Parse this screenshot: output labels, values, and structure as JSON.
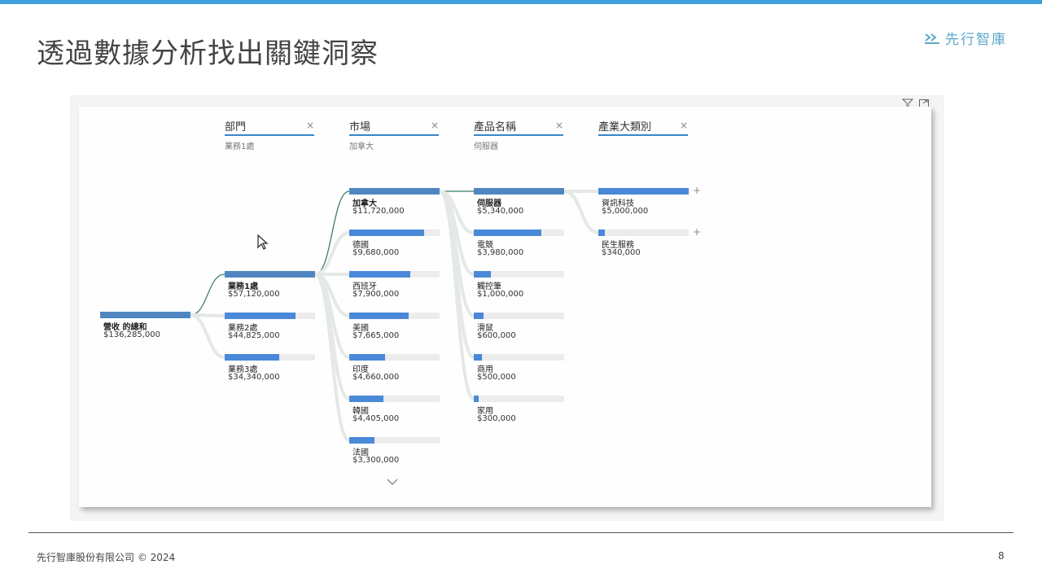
{
  "slide": {
    "title": "透過數據分析找出關鍵洞察",
    "logo_text": "先行智庫",
    "footer": "先行智庫股份有限公司  © 2024",
    "page_number": "8"
  },
  "visual_tools": [
    "filter-icon",
    "focus-mode-icon"
  ],
  "colors": {
    "accent": "#3f9fdc",
    "bar": "#4a88d8",
    "selected_bar": "#4f86c0",
    "track": "#ececec"
  },
  "tree": {
    "root": {
      "label": "營收 的總和",
      "value": "$136,285,000",
      "fraction": 1.0
    },
    "columns": [
      {
        "title": "部門",
        "selected": "業務1處",
        "nodes": [
          {
            "label": "業務1處",
            "value": "$57,120,000",
            "fraction": 1.0,
            "selected": true
          },
          {
            "label": "業務2處",
            "value": "$44,825,000",
            "fraction": 0.785
          },
          {
            "label": "業務3處",
            "value": "$34,340,000",
            "fraction": 0.601
          }
        ]
      },
      {
        "title": "市場",
        "selected": "加拿大",
        "nodes": [
          {
            "label": "加拿大",
            "value": "$11,720,000",
            "fraction": 1.0,
            "selected": true
          },
          {
            "label": "德國",
            "value": "$9,680,000",
            "fraction": 0.826
          },
          {
            "label": "西班牙",
            "value": "$7,900,000",
            "fraction": 0.674
          },
          {
            "label": "美國",
            "value": "$7,665,000",
            "fraction": 0.654
          },
          {
            "label": "印度",
            "value": "$4,660,000",
            "fraction": 0.398
          },
          {
            "label": "韓國",
            "value": "$4,405,000",
            "fraction": 0.376
          },
          {
            "label": "法國",
            "value": "$3,300,000",
            "fraction": 0.282
          }
        ]
      },
      {
        "title": "產品名稱",
        "selected": "伺服器",
        "nodes": [
          {
            "label": "伺服器",
            "value": "$5,340,000",
            "fraction": 1.0,
            "selected": true
          },
          {
            "label": "電競",
            "value": "$3,980,000",
            "fraction": 0.745
          },
          {
            "label": "觸控筆",
            "value": "$1,000,000",
            "fraction": 0.187
          },
          {
            "label": "滑鼠",
            "value": "$600,000",
            "fraction": 0.112
          },
          {
            "label": "商用",
            "value": "$500,000",
            "fraction": 0.094
          },
          {
            "label": "家用",
            "value": "$300,000",
            "fraction": 0.056
          }
        ]
      },
      {
        "title": "產業大類別",
        "selected": "",
        "nodes": [
          {
            "label": "資訊科技",
            "value": "$5,000,000",
            "fraction": 1.0,
            "expandable": true
          },
          {
            "label": "民生服務",
            "value": "$340,000",
            "fraction": 0.068,
            "expandable": true
          }
        ]
      }
    ]
  }
}
